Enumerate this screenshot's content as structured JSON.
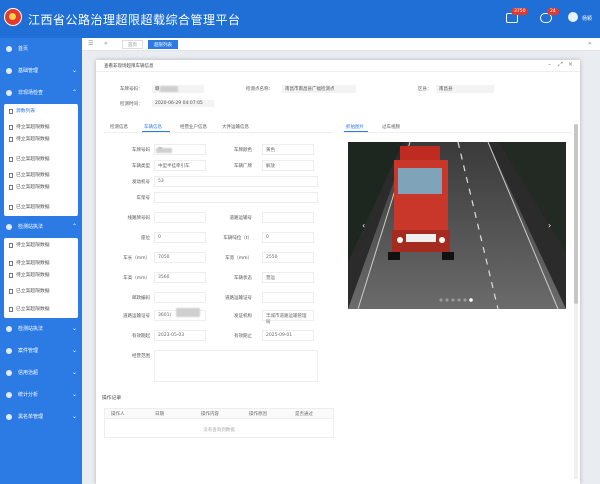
{
  "app": {
    "title": "江西省公路治理超限超载综合管理平台",
    "user": "杨颖"
  },
  "header_badges": {
    "msg": "3750",
    "alert": "24"
  },
  "sidebar": {
    "items": [
      {
        "label": "首页"
      },
      {
        "label": "基础管理"
      },
      {
        "label": "非现场检查"
      }
    ],
    "sub1": [
      "源数列表",
      "待立案超限数据",
      "待立案超限数据",
      "已立案超限数据",
      "已立案超限数据",
      "已立案超限数据",
      "已立案超限数据"
    ],
    "mid": {
      "label": "检测站执法"
    },
    "sub2": [
      "待立案超限数据",
      "待立案超限数据",
      "待立案超限数据",
      "已立案超限数据",
      "已立案超限数据"
    ],
    "bottom": [
      {
        "label": "检测站执法"
      },
      {
        "label": "案件管理"
      },
      {
        "label": "信用治超"
      },
      {
        "label": "统计分析"
      },
      {
        "label": "黑名单管理"
      }
    ]
  },
  "tabs": {
    "home": "首页",
    "active": "超限列表"
  },
  "modal": {
    "title": "查看非现场超限车辆信息",
    "plate_label": "车牌号码：",
    "plate_value": "赣",
    "site_label": "检测点名称：",
    "site_value": "南昌市南昌县广福检测点",
    "region_label": "区县：",
    "region_value": "南昌县",
    "time_label": "检测时间：",
    "time_value": "2020-06-29 04:07:05",
    "left_tabs": [
      "检测信息",
      "车辆信息",
      "经营业户信息",
      "大件运输信息"
    ],
    "right_tabs": [
      "抓拍图片",
      "过车视频"
    ],
    "fields": [
      {
        "label": "车牌号码",
        "value": "赣"
      },
      {
        "label": "车牌颜色",
        "value": "黄色"
      },
      {
        "label": "车辆类型",
        "value": "中型半挂牵引车"
      },
      {
        "label": "车辆厂牌",
        "value": "解放"
      },
      {
        "label": "发动机号",
        "value": "53"
      },
      {
        "label": "车架号",
        "value": ""
      },
      {
        "label": "线路牌号码",
        "value": ""
      },
      {
        "label": "道路运输号",
        "value": ""
      },
      {
        "label": "座位",
        "value": "0"
      },
      {
        "label": "车辆吨位（t）",
        "value": "0"
      },
      {
        "label": "车长（mm）",
        "value": "7050"
      },
      {
        "label": "车宽（mm）",
        "value": "2550"
      },
      {
        "label": "车高（mm）",
        "value": "3560"
      },
      {
        "label": "车辆状态",
        "value": "营运"
      },
      {
        "label": "邮政编码",
        "value": ""
      },
      {
        "label": "道路运输证号",
        "value": ""
      },
      {
        "label": "道路运输证号",
        "value": "3601("
      },
      {
        "label": "发证机构",
        "value": "丰城市道路运输管理局"
      },
      {
        "label": "有效期起",
        "value": "2023-05-03"
      },
      {
        "label": "有效期止",
        "value": "2025-09-01"
      },
      {
        "label": "经营范围",
        "value": ""
      }
    ],
    "ops_title": "操作记录",
    "ops_cols": [
      "操作人",
      "日期",
      "操作内容",
      "操作原因",
      "是否通过"
    ],
    "ops_empty": "没有查询到数据"
  }
}
